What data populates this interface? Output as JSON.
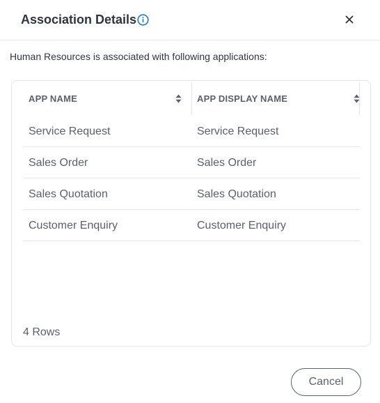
{
  "dialog": {
    "title": "Association Details",
    "close_label": "×",
    "description": "Human Resources is associated with following applications:",
    "colors": {
      "accent": "#1f7ac6",
      "text_dark": "#2f3441",
      "text_muted": "#5a606e",
      "border": "#e3e5e9"
    }
  },
  "table": {
    "columns": [
      {
        "label": "APP NAME"
      },
      {
        "label": "APP DISPLAY NAME"
      }
    ],
    "rows": [
      {
        "app_name": "Service Request",
        "display_name": "Service Request"
      },
      {
        "app_name": "Sales Order",
        "display_name": "Sales Order"
      },
      {
        "app_name": "Sales Quotation",
        "display_name": "Sales Quotation"
      },
      {
        "app_name": "Customer Enquiry",
        "display_name": "Customer Enquiry"
      }
    ],
    "row_count": "4 Rows"
  },
  "footer": {
    "cancel_label": "Cancel"
  }
}
